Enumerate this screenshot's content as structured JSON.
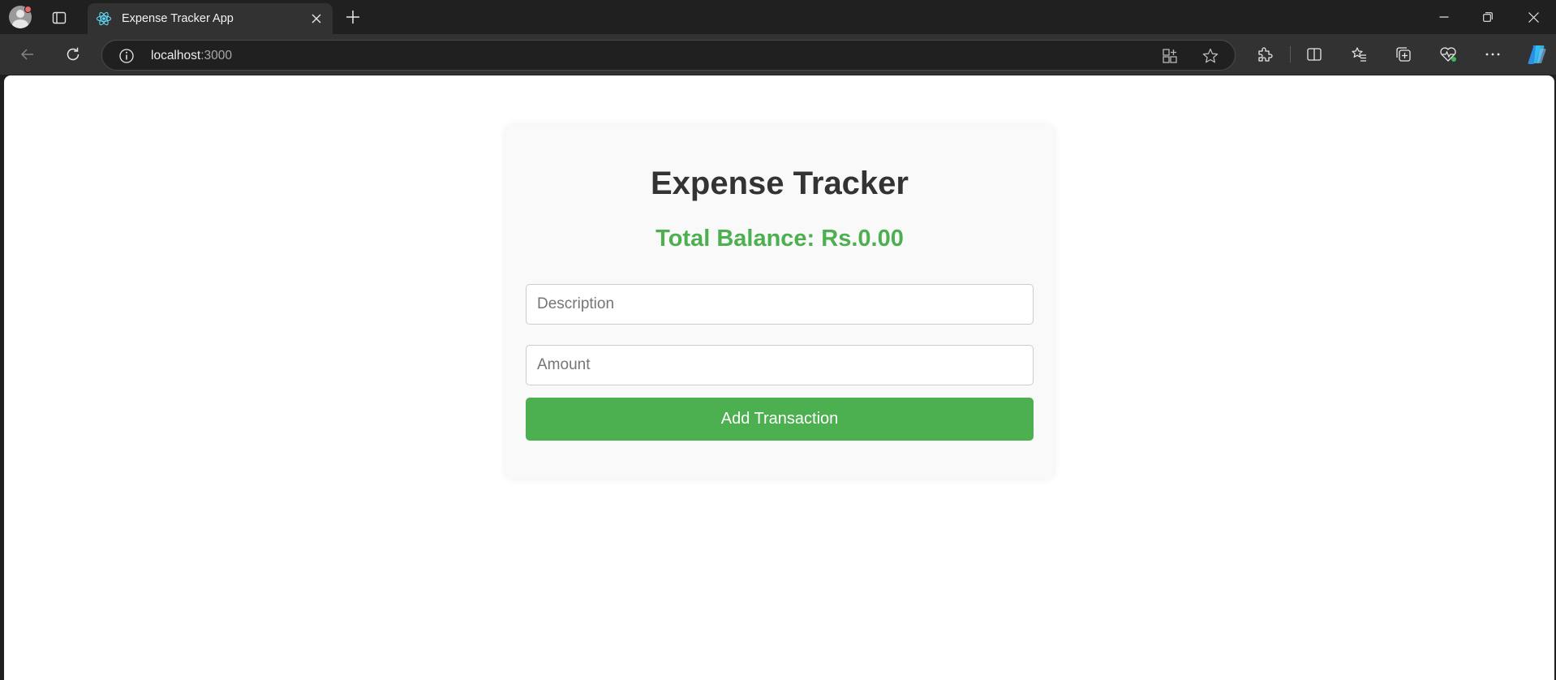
{
  "browser": {
    "tab": {
      "title": "Expense Tracker App"
    },
    "address": {
      "host": "localhost",
      "port": ":3000"
    },
    "colors": {
      "chrome_dark": "#202020",
      "toolbar": "#323232",
      "copilot_blue": "#2b8fe8"
    }
  },
  "app": {
    "title": "Expense Tracker",
    "balance_text": "Total Balance: Rs.0.00",
    "description_field": {
      "placeholder": "Description",
      "value": ""
    },
    "amount_field": {
      "placeholder": "Amount",
      "value": ""
    },
    "add_button_label": "Add Transaction",
    "colors": {
      "accent_green": "#4caf50",
      "title_text": "#333333",
      "card_bg": "#f9f9f9"
    }
  }
}
